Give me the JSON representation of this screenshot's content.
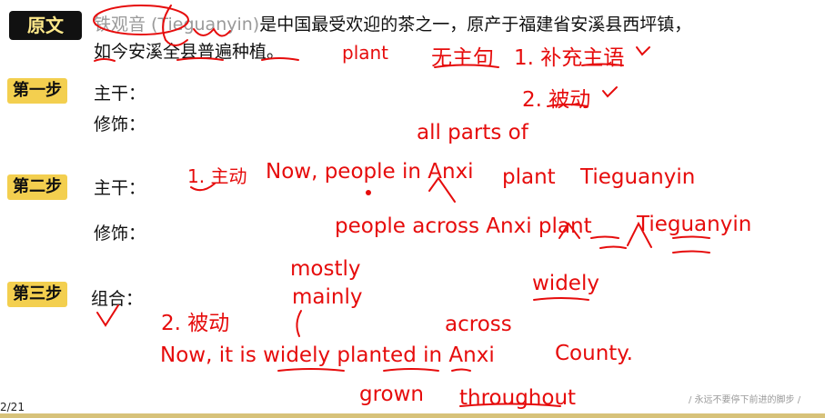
{
  "header": {
    "badge": "原文",
    "line1_faded": "铁观音 (Tieguanyin)",
    "line1_rest": "是中国最受欢迎的茶之一，原产于福建省安溪县西坪镇，",
    "line2": "如今安溪全县普遍种植。"
  },
  "steps": {
    "step1": {
      "badge": "第一步",
      "main_label": "主干：",
      "mod_label": "修饰："
    },
    "step2": {
      "badge": "第二步",
      "main_label": "主干：",
      "mod_label": "修饰："
    },
    "step3": {
      "badge": "第三步",
      "combine_label": "组合："
    }
  },
  "annotations": {
    "plant_top": "plant",
    "no_subject": "无主句",
    "add_subject": "1. 补充主语",
    "passive_1": "2. 被动",
    "all_parts_of": "all parts of",
    "active": "1. 主动",
    "now_people": "Now, people in Anxi",
    "plant_mid": "plant",
    "tieguanyin_mid": "Tieguanyin",
    "people_across": "people across Anxi plant",
    "tieguanyin_mod": "Tieguanyin",
    "mostly": "mostly",
    "mainly": "mainly",
    "widely": "widely",
    "passive_2": "2. 被动",
    "across": "across",
    "final_sentence": "Now,  it is widely planted  in Anxi",
    "county": "County.",
    "grown": "grown",
    "throughout": "throughout"
  },
  "footer": {
    "page_number": "2/21",
    "slogan": "/ 永远不要停下前进的脚步 /"
  },
  "colors": {
    "annotation": "#e60c0c",
    "badge": "#f3cf4f",
    "dark_badge": "#111111",
    "footer_bar": "#d7c27a"
  }
}
